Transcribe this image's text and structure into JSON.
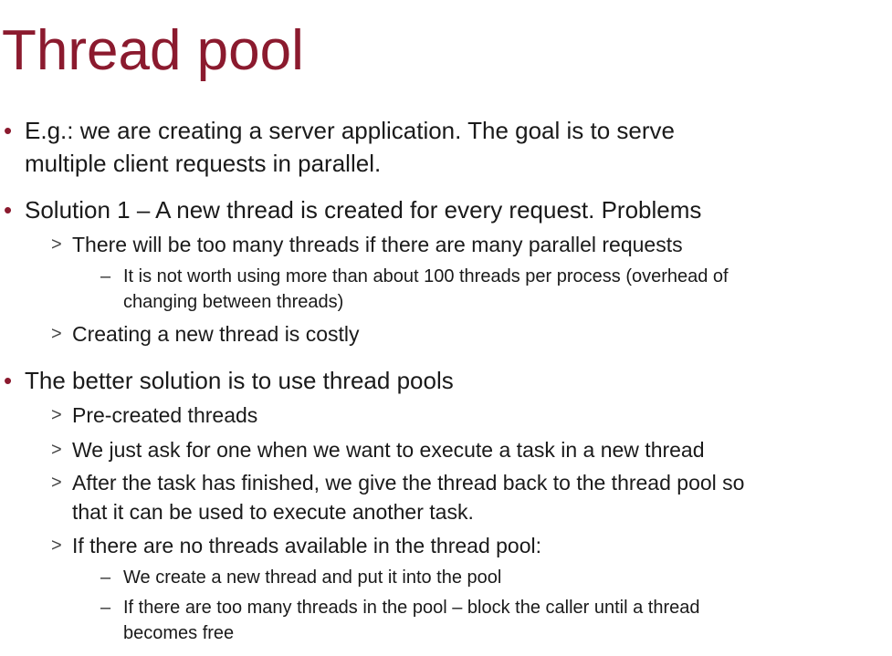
{
  "slide": {
    "title": "Thread pool",
    "bullets": [
      {
        "marker": "•",
        "lines": [
          "E.g.: we are creating a server application. The goal is to serve",
          "multiple client requests in parallel."
        ]
      },
      {
        "marker": "•",
        "lines": [
          "Solution 1 – A new thread is created for every request. Problems"
        ],
        "sub": [
          {
            "marker": ">",
            "lines": [
              "There will be too many threads if there are many parallel requests"
            ],
            "sub": [
              {
                "marker": "–",
                "lines": [
                  "It is not worth using more than about 100 threads per process (overhead of",
                  "changing between threads)"
                ]
              }
            ]
          },
          {
            "marker": ">",
            "lines": [
              "Creating a new thread is costly"
            ]
          }
        ]
      },
      {
        "marker": "•",
        "lines": [
          "The better solution is to use thread pools"
        ],
        "sub": [
          {
            "marker": ">",
            "lines": [
              "Pre-created threads"
            ]
          },
          {
            "marker": ">",
            "lines": [
              "We just ask for one when we want to execute a task in a new thread"
            ]
          },
          {
            "marker": ">",
            "lines": [
              "After the task has finished, we give the thread back to the thread pool so",
              "that it can be used to execute another task."
            ]
          },
          {
            "marker": ">",
            "lines": [
              "If there are no threads available in the thread pool:"
            ],
            "sub": [
              {
                "marker": "–",
                "lines": [
                  "We create a new thread and put it into the pool"
                ]
              },
              {
                "marker": "–",
                "lines": [
                  "If there are too many threads in the pool – block the caller until a thread",
                  "becomes free"
                ]
              }
            ]
          }
        ]
      }
    ]
  }
}
